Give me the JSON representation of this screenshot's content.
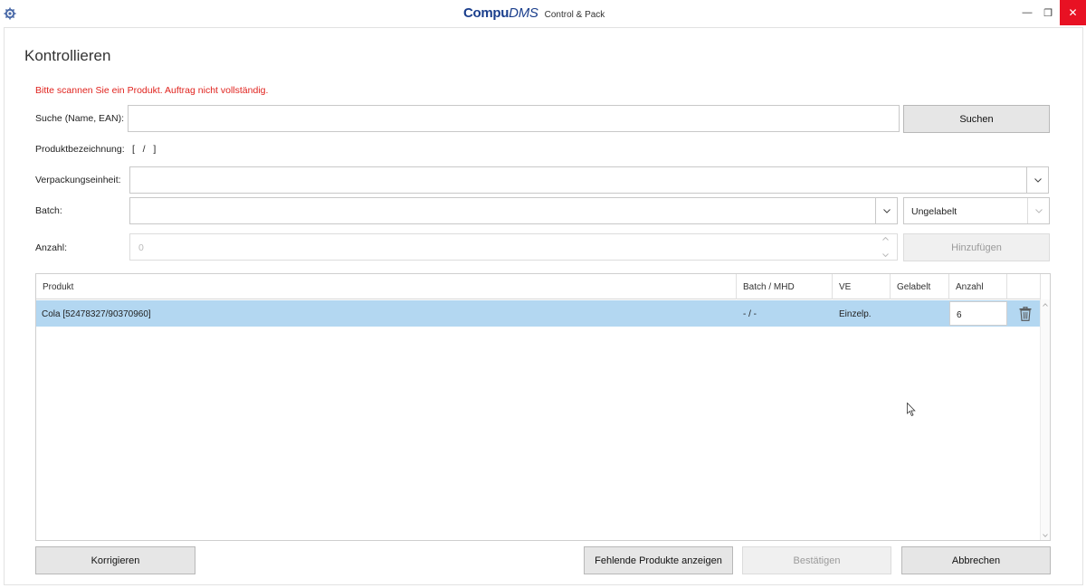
{
  "window": {
    "brand_bold": "Compu",
    "brand_italic": "DMS",
    "subtitle": "Control & Pack",
    "minimize_glyph": "—",
    "maximize_glyph": "❐",
    "close_glyph": "✕"
  },
  "page": {
    "title": "Kontrollieren",
    "warning": "Bitte scannen Sie ein Produkt. Auftrag nicht vollständig."
  },
  "form": {
    "search_label": "Suche (Name, EAN):",
    "search_value": "",
    "search_button": "Suchen",
    "product_label": "Produktbezeichnung:",
    "product_value": "[   /   ]",
    "packaging_label": "Verpackungseinheit:",
    "packaging_value": "",
    "batch_label": "Batch:",
    "batch_value": "",
    "label_status": "Ungelabelt",
    "quantity_label": "Anzahl:",
    "quantity_value": "0",
    "add_button": "Hinzufügen"
  },
  "table": {
    "columns": [
      "Produkt",
      "Batch / MHD",
      "VE",
      "Gelabelt",
      "Anzahl"
    ],
    "rows": [
      {
        "product": "Cola  [52478327/90370960]",
        "batch": "- / -",
        "ve": "Einzelp.",
        "labeled": "",
        "quantity": "6",
        "selected": true
      }
    ]
  },
  "footer": {
    "correct_button": "Korrigieren",
    "missing_button": "Fehlende Produkte anzeigen",
    "confirm_button": "Bestätigen",
    "cancel_button": "Abbrechen"
  },
  "colors": {
    "brand": "#1a3e8c",
    "warning": "#e0231e",
    "selection": "#b3d7f1",
    "close": "#e81123"
  },
  "icons": {
    "app": "gear-icon",
    "dropdown": "chevron-down-icon",
    "delete": "trash-icon",
    "spinner_up": "chevron-up-icon",
    "spinner_down": "chevron-down-icon"
  }
}
